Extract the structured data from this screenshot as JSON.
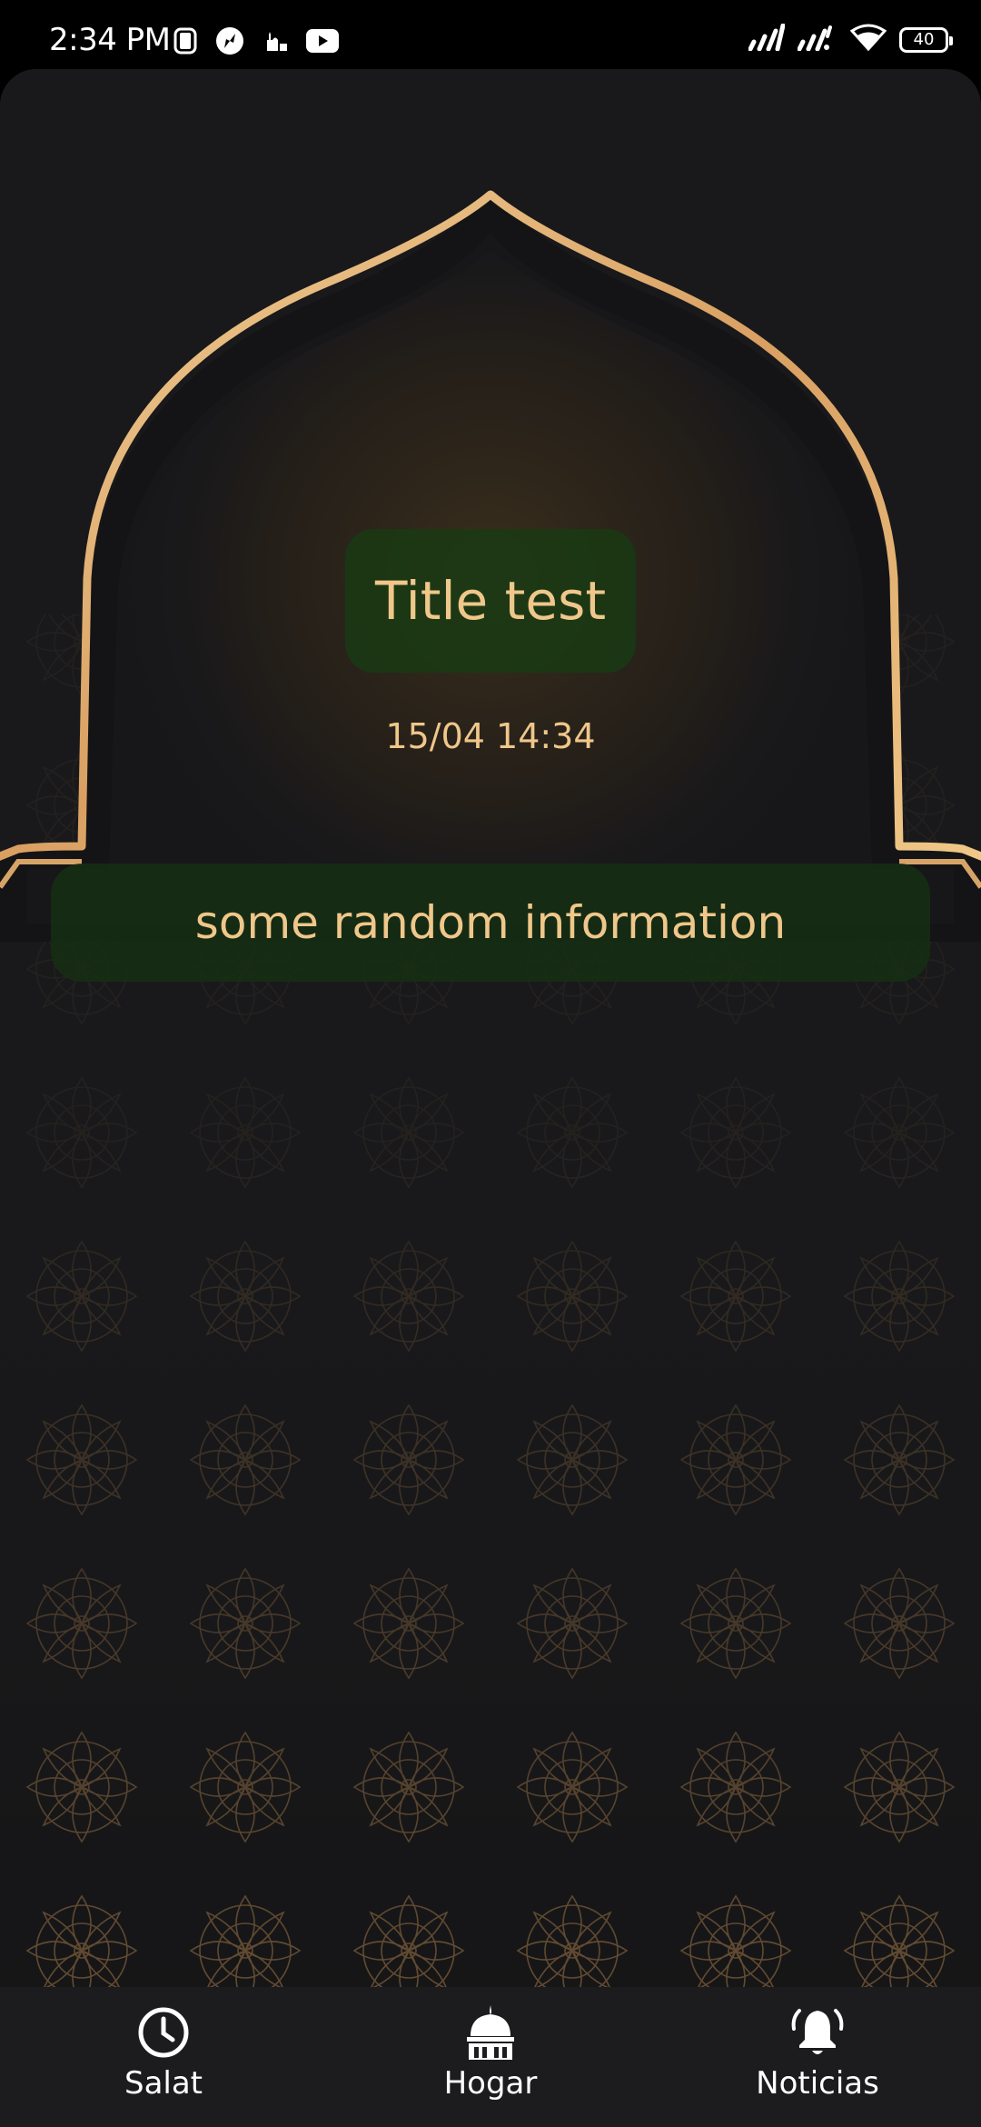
{
  "status_bar": {
    "time": "2:34 PM",
    "left_icons": [
      "notification-app-icon",
      "compass-icon",
      "mosque-icon",
      "youtube-icon"
    ],
    "right_icons": [
      "signal-icon",
      "signal-icon",
      "wifi-icon",
      "battery-icon"
    ],
    "battery_level": "40"
  },
  "card": {
    "title": "Title test",
    "datetime": "15/04 14:34",
    "info": "some random information"
  },
  "bottom_nav": {
    "items": [
      {
        "label": "Salat",
        "icon": "clock-icon"
      },
      {
        "label": "Hogar",
        "icon": "mosque-icon"
      },
      {
        "label": "Noticias",
        "icon": "bell-icon"
      }
    ]
  },
  "colors": {
    "background": "#19191b",
    "accent_gold": "#efc78a",
    "pill_green": "#183a14",
    "nav_background": "#1c1c1e"
  }
}
